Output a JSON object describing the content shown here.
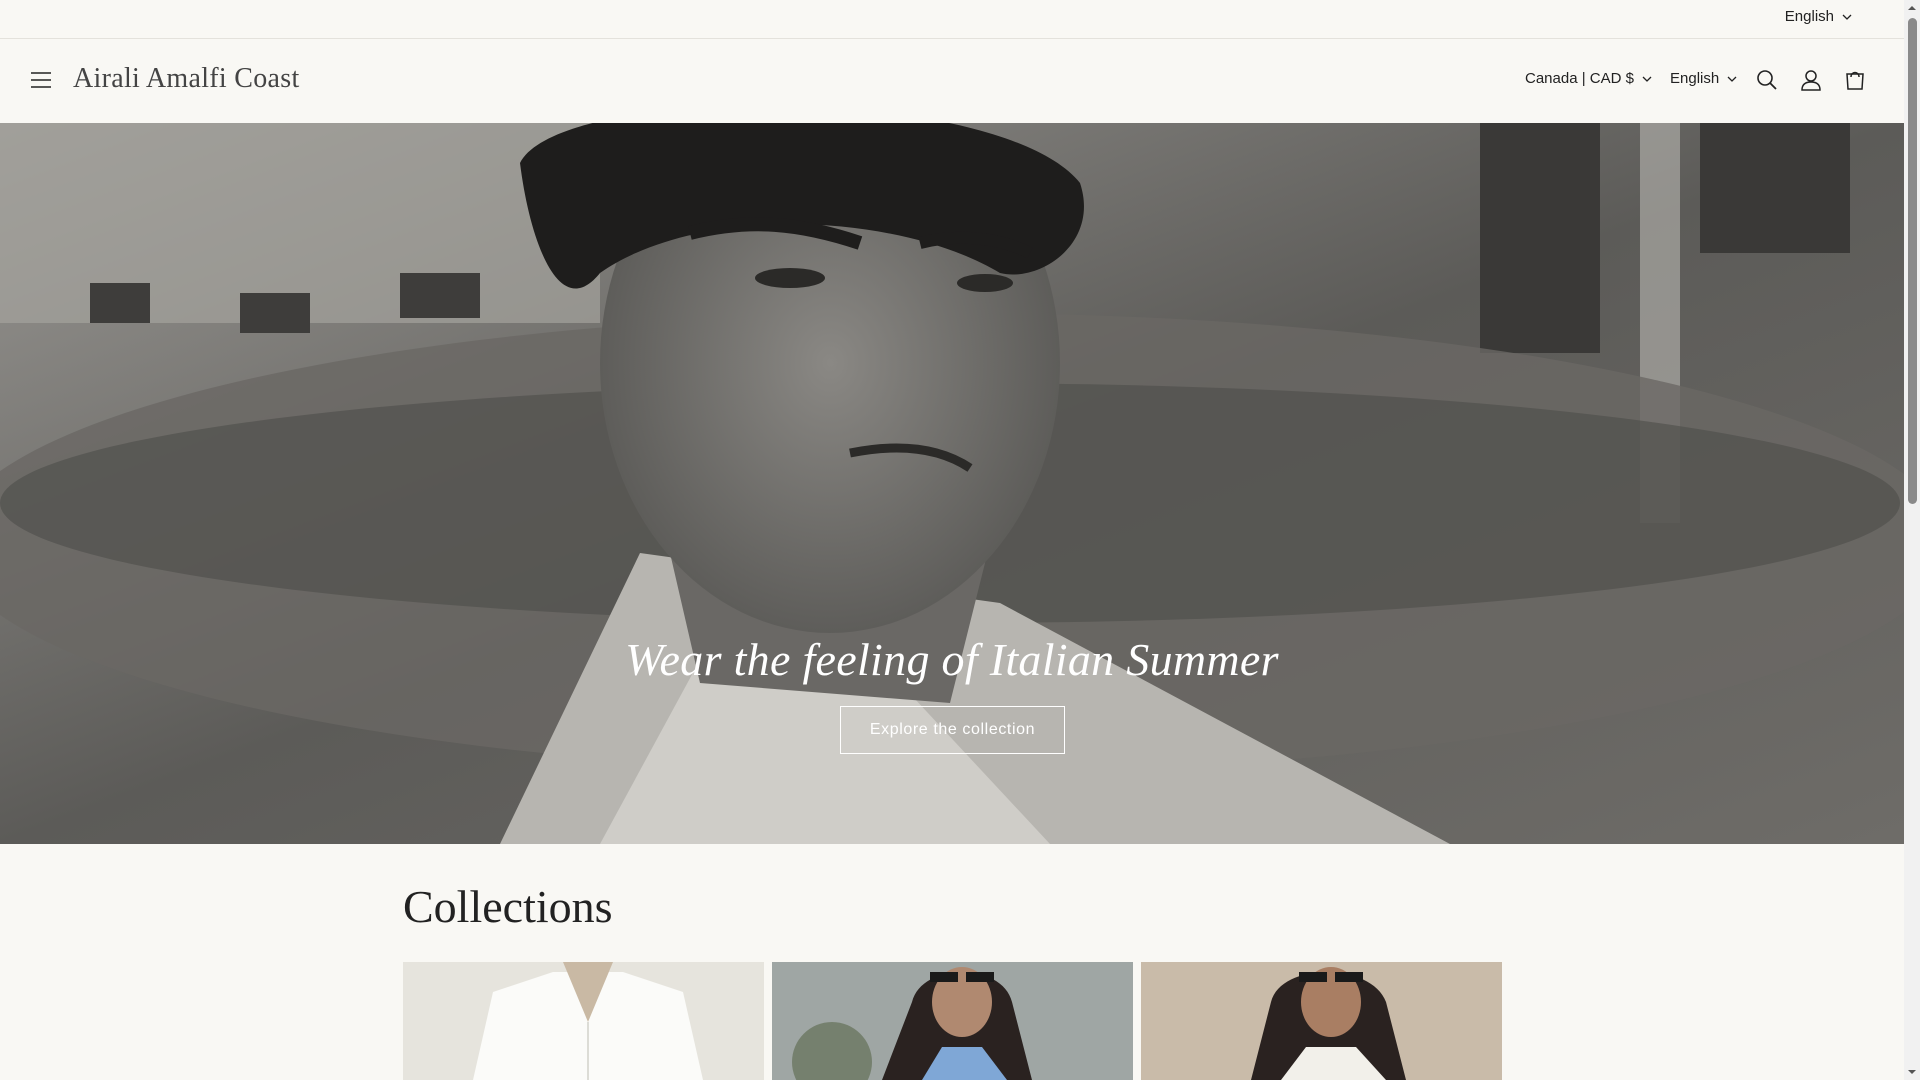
{
  "topbar": {
    "language": "English"
  },
  "header": {
    "brand": "Airali Amalfi Coast",
    "country_currency": "Canada | CAD $",
    "language": "English",
    "icons": [
      "menu-icon",
      "search-icon",
      "account-icon",
      "cart-icon"
    ]
  },
  "hero": {
    "title": "Wear the feeling of Italian Summer",
    "button_label": "Explore the collection"
  },
  "collections": {
    "title": "Collections"
  },
  "colors": {
    "background": "#f9f8f4",
    "text": "#222222",
    "hero_overlay": "#5a5a5a"
  }
}
